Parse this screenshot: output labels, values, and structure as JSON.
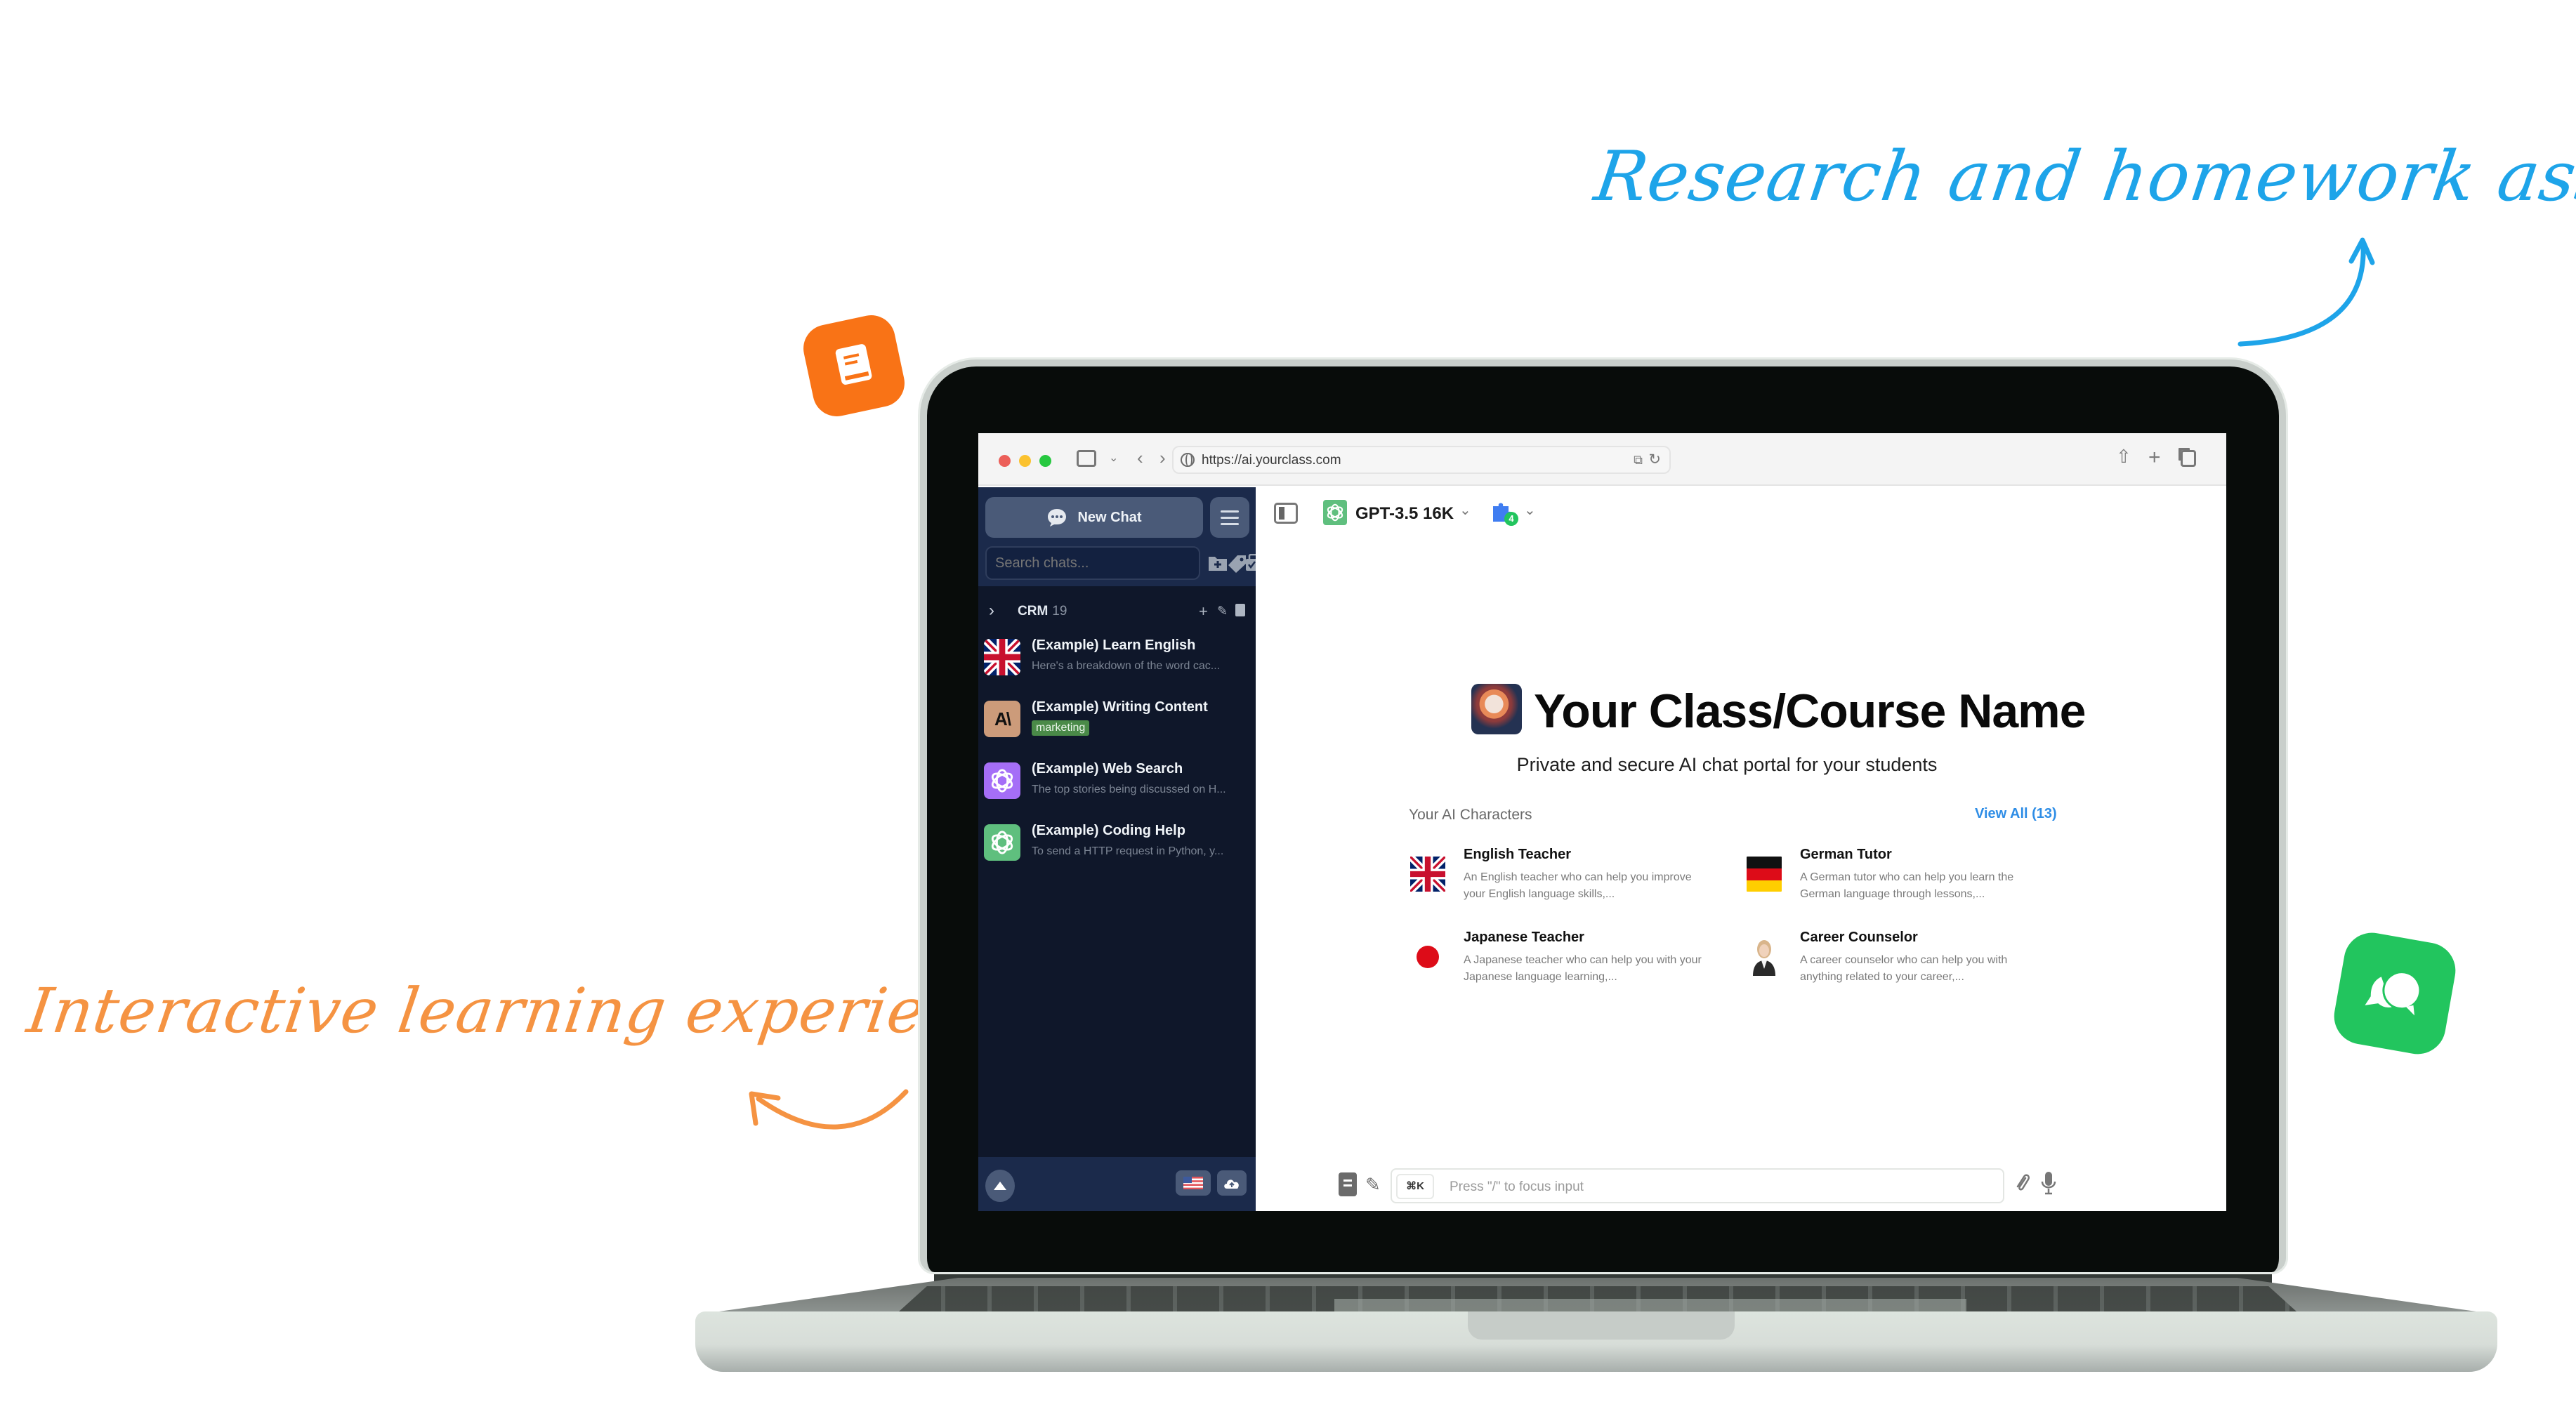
{
  "annotations": {
    "top_right": "Research and homework assistance",
    "left": "Interactive learning experience"
  },
  "colors": {
    "annotation_blue": "#1ea4e9",
    "annotation_orange": "#f59342",
    "badge_orange": "#f97316",
    "badge_green": "#22c55e",
    "sidebar_bg": "#0f172a",
    "sidebar_header_bg": "#1b2a4b",
    "accent_link": "#2e8de6",
    "tag_green": "#4a8a48"
  },
  "floating_badges": [
    {
      "icon": "book-icon",
      "color": "orange"
    },
    {
      "icon": "chat-bubbles-icon",
      "color": "green"
    }
  ],
  "browser": {
    "url": "https://ai.yourclass.com",
    "icons": [
      "sidebar-icon",
      "chevron-down-icon",
      "back-icon",
      "forward-icon",
      "translate-icon",
      "reload-icon",
      "share-icon",
      "new-tab-icon",
      "tabs-overview-icon"
    ]
  },
  "sidebar": {
    "new_chat_label": "New Chat",
    "search_placeholder": "Search chats...",
    "folder": {
      "name": "CRM",
      "count": "19"
    },
    "chats": [
      {
        "title": "(Example) Learn English",
        "subtitle": "Here's a breakdown of the word cac...",
        "avatar": "uk-flag"
      },
      {
        "title": "(Example) Writing Content",
        "tag": "marketing",
        "avatar": "anthropic-logo"
      },
      {
        "title": "(Example) Web Search",
        "subtitle": "The top stories being discussed on H...",
        "avatar": "openai-logo-purple"
      },
      {
        "title": "(Example) Coding Help",
        "subtitle": "To send a HTTP request in Python, y...",
        "avatar": "openai-logo-green"
      }
    ],
    "footer": {
      "language_flag": "us-flag",
      "upload_icon": "cloud-upload-icon"
    }
  },
  "main": {
    "model_name": "GPT-3.5 16K",
    "plugin_count": "4",
    "title": "Your Class/Course Name",
    "subtitle": "Private and secure AI chat portal for your students",
    "characters_heading": "Your AI Characters",
    "view_all_label": "View All (13)",
    "characters": [
      {
        "name": "English Teacher",
        "description": "An English teacher who can help you improve your English language skills,...",
        "icon": "uk-flag"
      },
      {
        "name": "German Tutor",
        "description": "A German tutor who can help you learn the German language through lessons,...",
        "icon": "germany-flag"
      },
      {
        "name": "Japanese Teacher",
        "description": "A Japanese teacher who can help you with your Japanese language learning,...",
        "icon": "japan-flag"
      },
      {
        "name": "Career Counselor",
        "description": "A career counselor who can help you with anything related to your career,...",
        "icon": "person-avatar"
      }
    ],
    "input": {
      "shortcut": "⌘K",
      "placeholder": "Press \"/\" to focus input"
    }
  }
}
